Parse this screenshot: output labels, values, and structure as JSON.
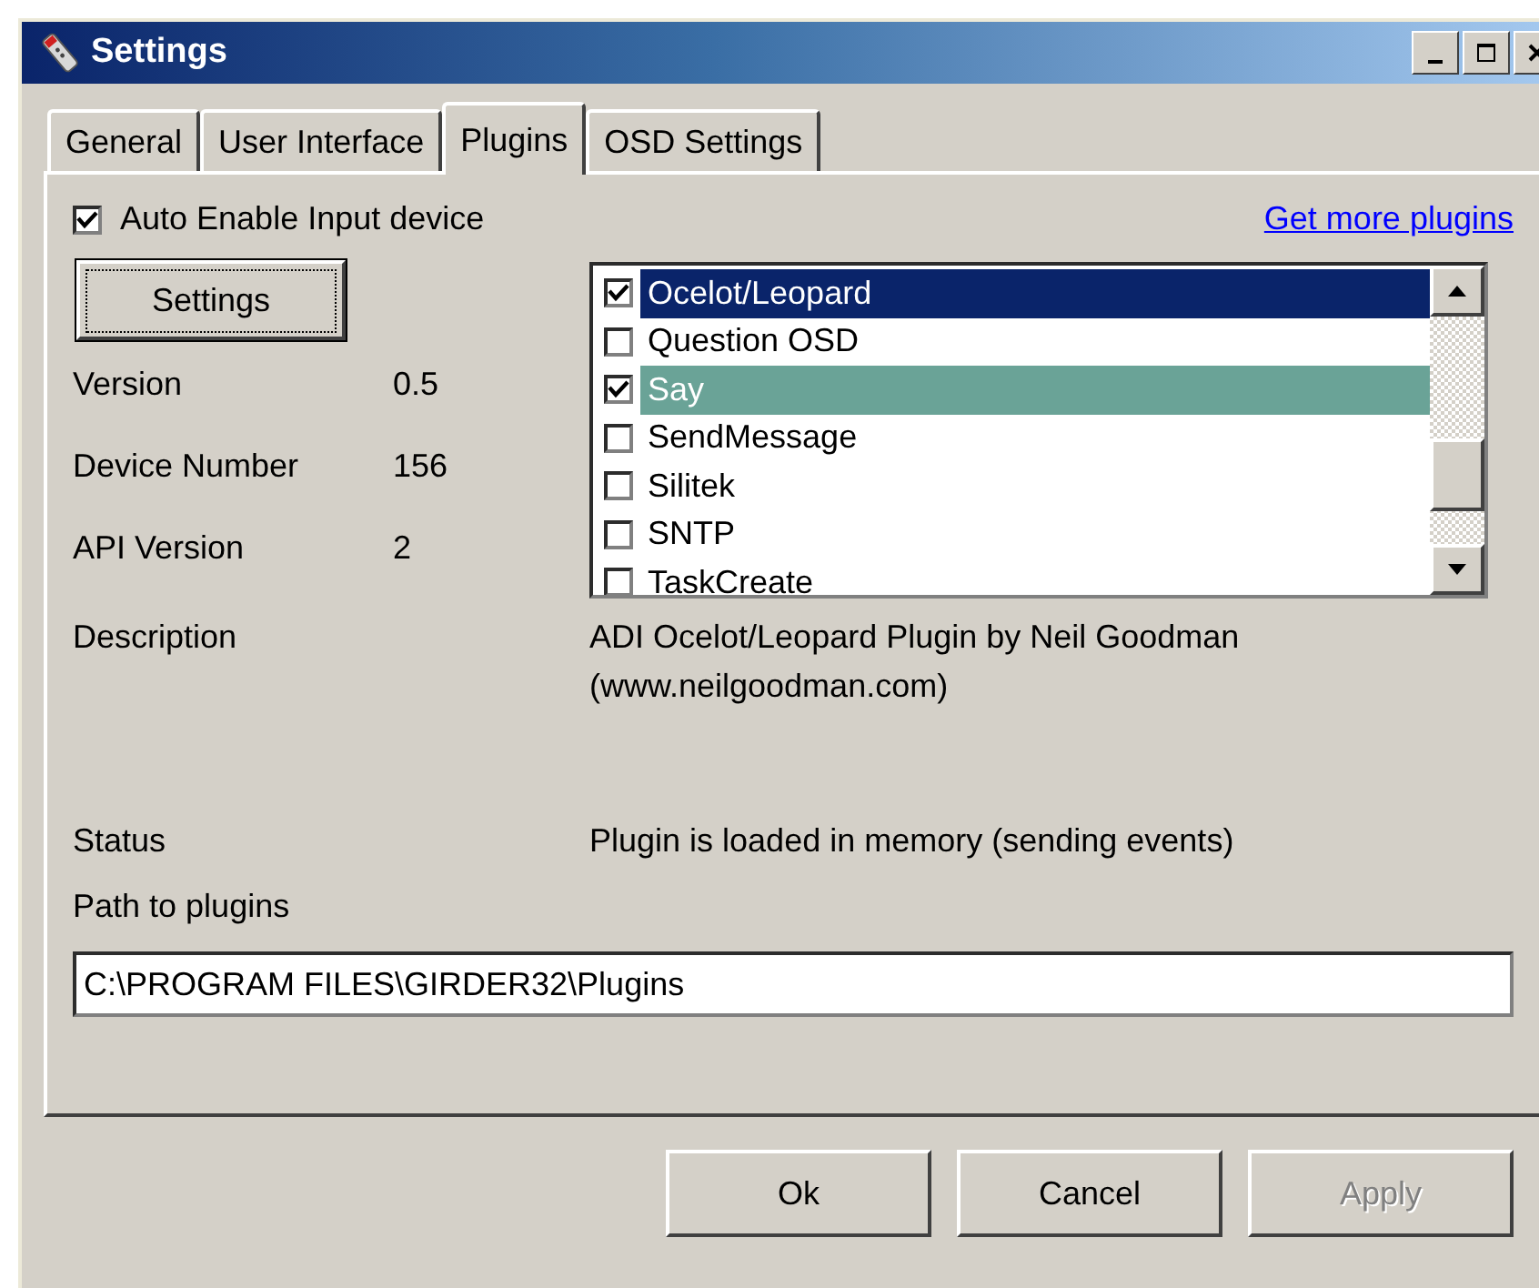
{
  "window": {
    "title": "Settings"
  },
  "tabs": [
    {
      "label": "General",
      "selected": false
    },
    {
      "label": "User Interface",
      "selected": false
    },
    {
      "label": "Plugins",
      "selected": true
    },
    {
      "label": "OSD Settings",
      "selected": false
    }
  ],
  "auto_enable": {
    "label": "Auto Enable Input device",
    "checked": true
  },
  "more_link": "Get more plugins",
  "settings_button": "Settings",
  "info": [
    {
      "label": "Version",
      "value": "0.5"
    },
    {
      "label": "Device Number",
      "value": "156"
    },
    {
      "label": "API Version",
      "value": "2"
    }
  ],
  "plugins": [
    {
      "name": "Ocelot/Leopard",
      "checked": true,
      "selected": true,
      "highlighted": false
    },
    {
      "name": "Question OSD",
      "checked": false,
      "selected": false,
      "highlighted": false
    },
    {
      "name": "Say",
      "checked": true,
      "selected": false,
      "highlighted": true
    },
    {
      "name": "SendMessage",
      "checked": false,
      "selected": false,
      "highlighted": false
    },
    {
      "name": "Silitek",
      "checked": false,
      "selected": false,
      "highlighted": false
    },
    {
      "name": "SNTP",
      "checked": false,
      "selected": false,
      "highlighted": false
    },
    {
      "name": "TaskCreate",
      "checked": false,
      "selected": false,
      "highlighted": false
    }
  ],
  "description": {
    "label": "Description",
    "value": "ADI Ocelot/Leopard Plugin by Neil Goodman (www.neilgoodman.com)"
  },
  "status": {
    "label": "Status",
    "value": "Plugin is loaded in memory (sending events)"
  },
  "path": {
    "label": "Path to plugins",
    "value": "C:\\PROGRAM FILES\\GIRDER32\\Plugins"
  },
  "buttons": [
    {
      "label": "Ok",
      "disabled": false
    },
    {
      "label": "Cancel",
      "disabled": false
    },
    {
      "label": "Apply",
      "disabled": true
    }
  ]
}
